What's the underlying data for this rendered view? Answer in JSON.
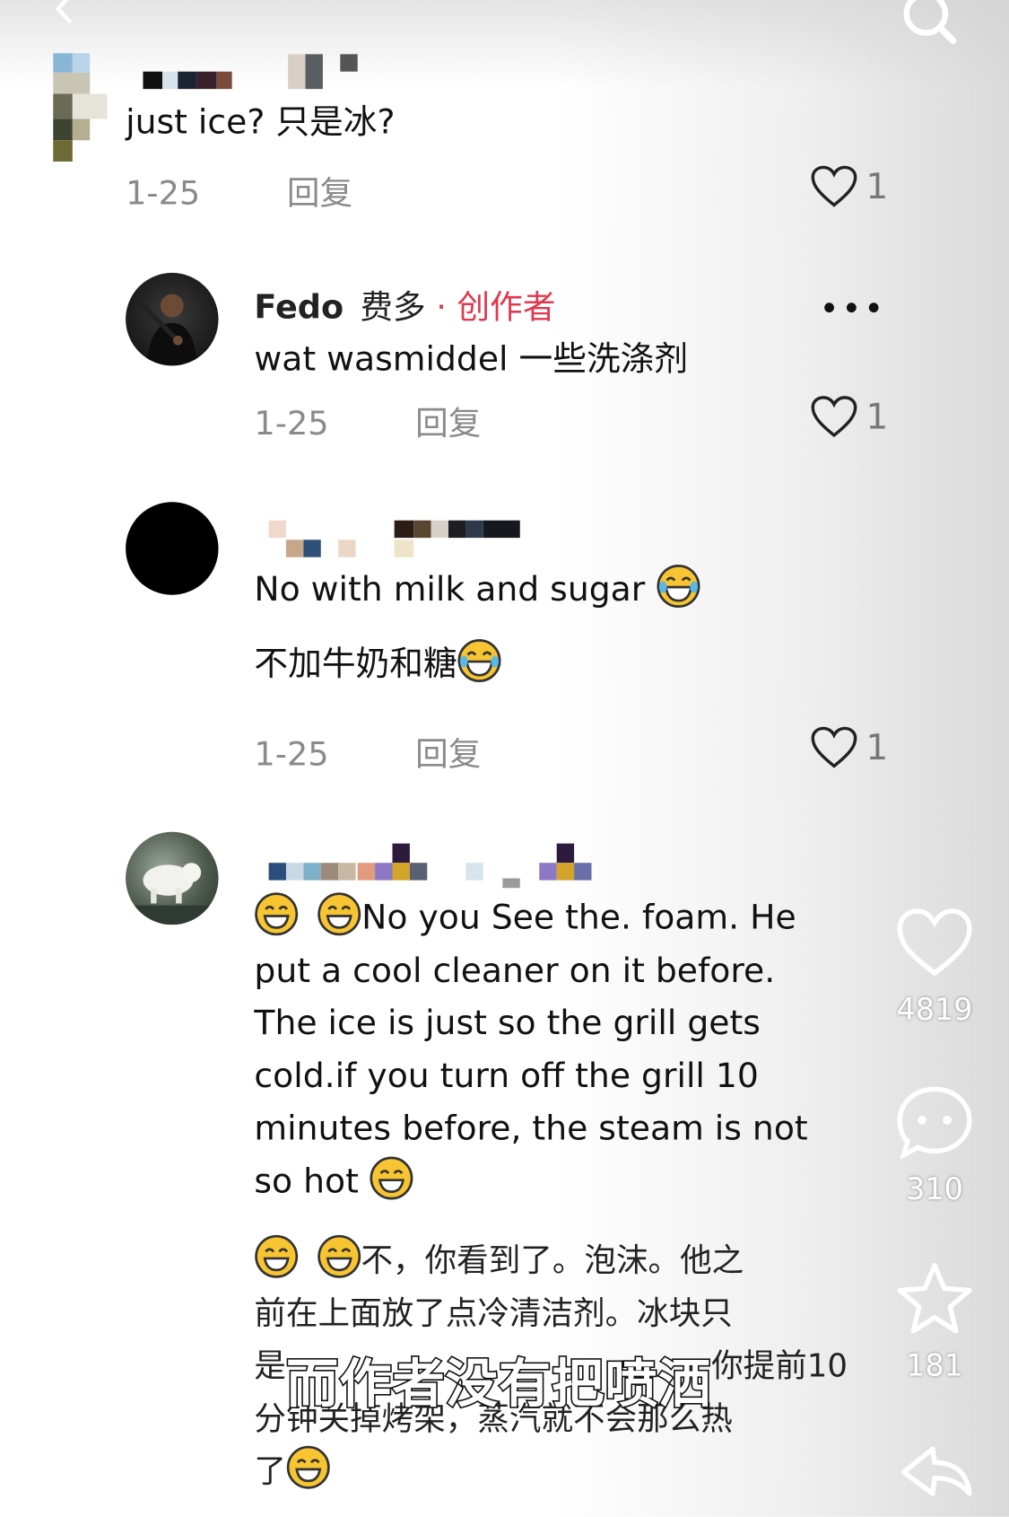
{
  "comments": [
    {
      "text_lines": [
        "just ice?  只是冰?"
      ],
      "date": "1-25",
      "reply": "回复",
      "likes": "1"
    },
    {
      "name": "Fedo",
      "name_cn": "费多",
      "creator_tag": "· 创作者",
      "text_lines": [
        "wat wasmiddel  一些洗涤剂"
      ],
      "date": "1-25",
      "reply": "回复",
      "likes": "1"
    },
    {
      "text_lines": [
        "No with milk and sugar",
        "不加牛奶和糖"
      ],
      "date": "1-25",
      "reply": "回复",
      "likes": "1"
    },
    {
      "text_lines": [
        "No you See the. foam. He",
        "put a cool cleaner on it before.",
        "The ice is just so the grill gets",
        "cold.if you turn off the grill 10",
        "minutes before, the steam is not",
        "so hot",
        "不，你看到了。泡沫。他之",
        "前在上面放了点冷清洁剂。冰块只",
        "是",
        "你提前10",
        "分钟关掉烤架，蒸汽就不会那么热",
        "了"
      ]
    }
  ],
  "rail": {
    "likes": "4819",
    "comments": "310",
    "favorites": "181"
  },
  "subtitle": "而作者没有把喷洒",
  "colors": {
    "creator_red": "#e0384f",
    "meta_gray": "#8a8a8a",
    "emoji_yellow": "#f7c531"
  }
}
